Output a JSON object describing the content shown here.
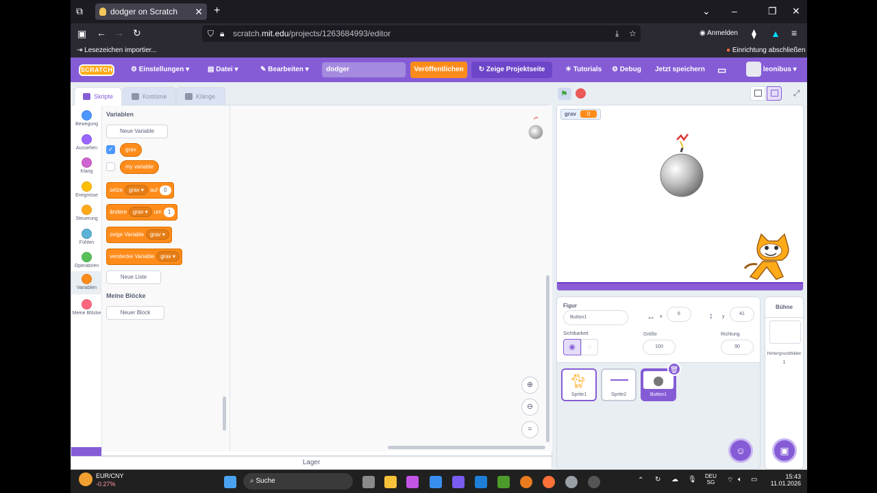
{
  "browser": {
    "tab_title": "dodger on Scratch",
    "url_prefix": "scratch.",
    "url_domain": "mit.edu",
    "url_path": "/projects/1263684993/editor",
    "account_label": "Anmelden",
    "bookmark_import": "Lesezeichen importier...",
    "finish_setup": "Einrichtung abschließen"
  },
  "menubar": {
    "logo": "SCRATCH",
    "settings": "Einstellungen",
    "file": "Datei",
    "edit": "Bearbeiten",
    "project_name": "dodger",
    "publish": "Veröffentlichen",
    "project_page": "Zeige Projektseite",
    "tutorials": "Tutorials",
    "debug": "Debug",
    "save_now": "Jetzt speichern",
    "username": "leonibus"
  },
  "editor_tabs": {
    "code": "Skripte",
    "costumes": "Kostüme",
    "sounds": "Klänge"
  },
  "categories": [
    {
      "label": "Bewegung",
      "color": "#4c97ff"
    },
    {
      "label": "Aussehen",
      "color": "#9966ff"
    },
    {
      "label": "Klang",
      "color": "#cf63cf"
    },
    {
      "label": "Ereignisse",
      "color": "#ffbf00"
    },
    {
      "label": "Steuerung",
      "color": "#ffab19"
    },
    {
      "label": "Fühlen",
      "color": "#5cb1d6"
    },
    {
      "label": "Operatoren",
      "color": "#59c059"
    },
    {
      "label": "Variablen",
      "color": "#ff8c1a"
    },
    {
      "label": "Meine Blöcke",
      "color": "#ff6680"
    }
  ],
  "palette": {
    "variables_heading": "Variablen",
    "new_variable": "Neue Variable",
    "var_grav": "grav",
    "var_my": "my variable",
    "set_block": {
      "word1": "setze",
      "var": "grav",
      "word2": "auf",
      "value": "0"
    },
    "change_block": {
      "word1": "ändere",
      "var": "grav",
      "word2": "um",
      "value": "1"
    },
    "show_block": {
      "word1": "zeige Variable",
      "var": "grav"
    },
    "hide_block": {
      "word1": "verstecke Variable",
      "var": "grav"
    },
    "new_list": "Neue Liste",
    "my_blocks_heading": "Meine Blöcke",
    "new_block": "Neuer Block"
  },
  "lager": "Lager",
  "stage": {
    "monitor_label": "grav",
    "monitor_value": "0"
  },
  "sprite_info": {
    "sprite_label": "Figur",
    "sprite_name": "Button1",
    "x_label": "x",
    "x_value": "6",
    "y_label": "y",
    "y_value": "41",
    "visibility_label": "Sichtbarkeit",
    "size_label": "Größe",
    "size_value": "100",
    "direction_label": "Richtung",
    "direction_value": "90"
  },
  "sprites": [
    "Sprite1",
    "Sprite2",
    "Button1"
  ],
  "stage_panel": {
    "title": "Bühne",
    "backdrops_label": "Hintergrundbilder",
    "backdrops_count": "1"
  },
  "taskbar": {
    "ticker_name": "EUR/CNY",
    "ticker_change": "-0.27%",
    "search": "Suche",
    "lang_line1": "DEU",
    "lang_line2": "SG",
    "time": "15:43",
    "date": "11.01.2026"
  }
}
